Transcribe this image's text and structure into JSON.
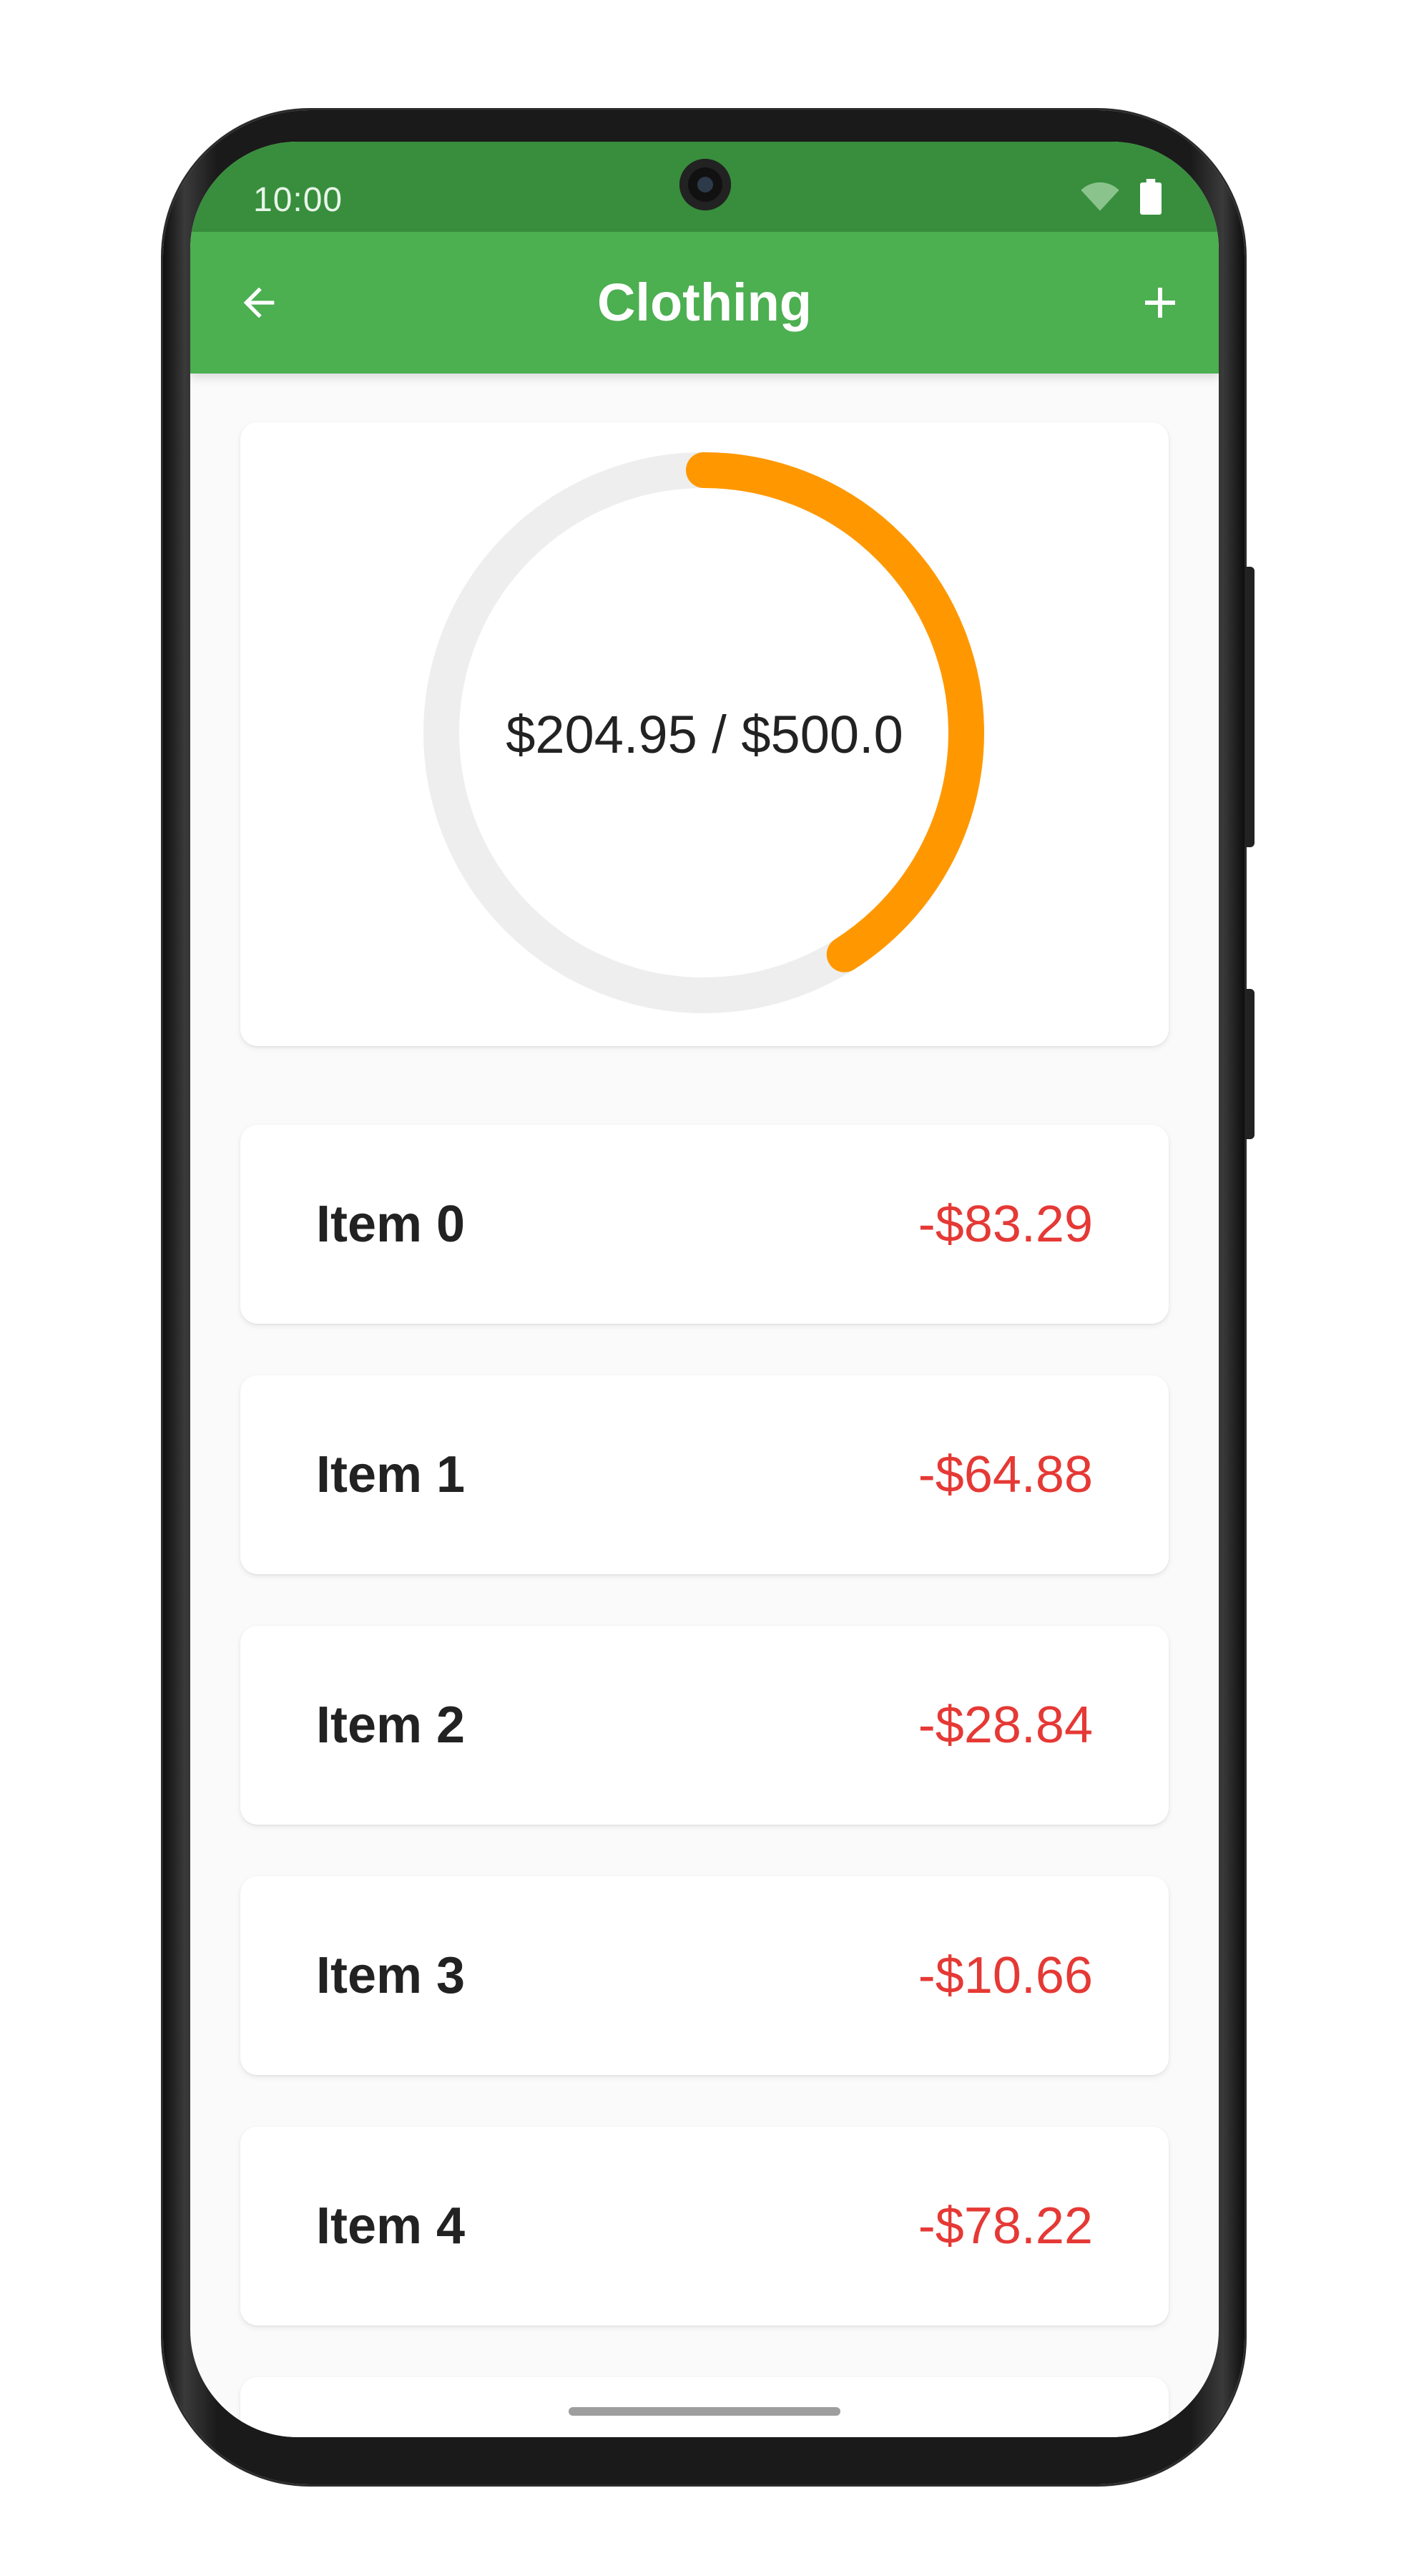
{
  "status_bar": {
    "time": "10:00",
    "icons": [
      "wifi-icon",
      "battery-icon"
    ]
  },
  "app_bar": {
    "title": "Clothing",
    "back_icon": "arrow-back-icon",
    "add_icon": "add-icon"
  },
  "budget": {
    "spent": 204.95,
    "limit": 500.0,
    "label": "$204.95 / $500.0",
    "progress_fraction": 0.4099
  },
  "items": [
    {
      "name": "Item 0",
      "amount": "-$83.29"
    },
    {
      "name": "Item 1",
      "amount": "-$64.88"
    },
    {
      "name": "Item 2",
      "amount": "-$28.84"
    },
    {
      "name": "Item 3",
      "amount": "-$10.66"
    },
    {
      "name": "Item 4",
      "amount": "-$78.22"
    }
  ],
  "colors": {
    "status_bar": "#388e3c",
    "app_bar": "#4caf50",
    "progress": "#ff9800",
    "track": "#eeeeee",
    "amount_negative": "#e53935"
  }
}
